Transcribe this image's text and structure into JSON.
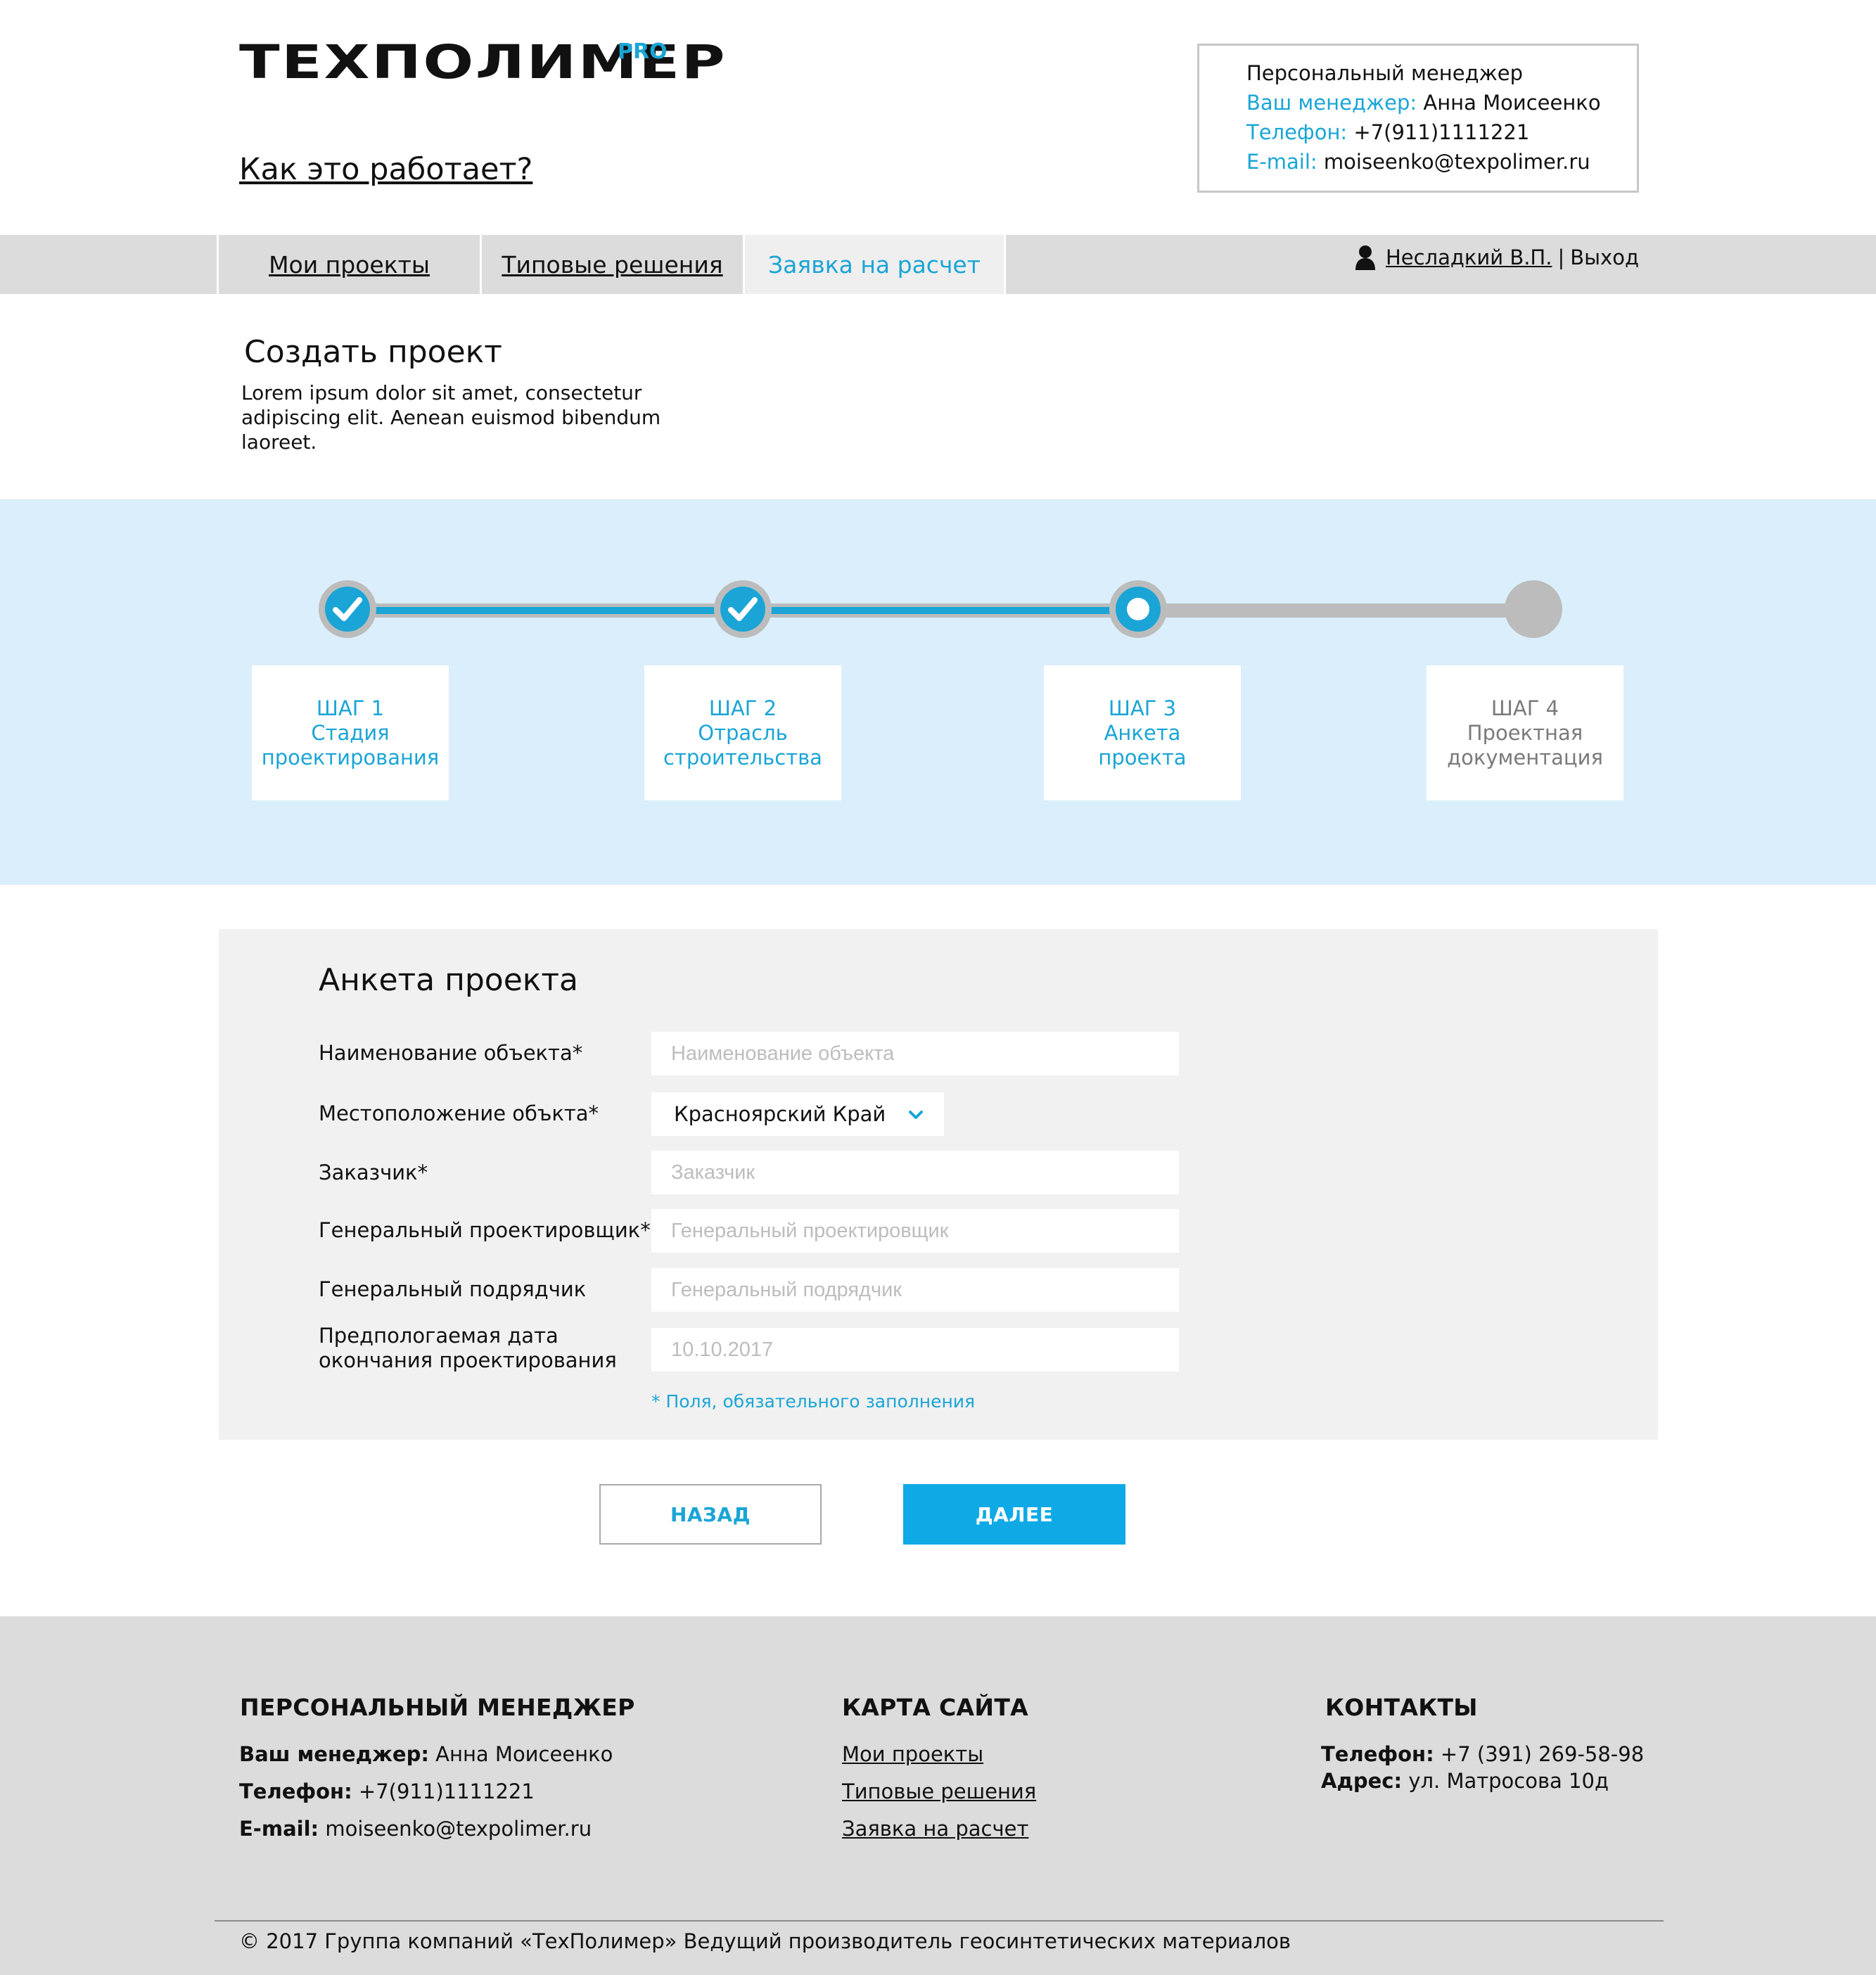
{
  "header": {
    "logo_text": "ТЕХПОЛИМЕР",
    "logo_suffix": "PRO",
    "how_it_works": "Как это работает?",
    "manager_box": {
      "title": "Персональный менеджер",
      "manager_label": "Ваш менеджер:",
      "manager_value": "Анна Моисеенко",
      "phone_label": "Телефон:",
      "phone_value": "+7(911)1111221",
      "email_label": "E-mail:",
      "email_value": "moiseenko@texpolimer.ru"
    }
  },
  "nav": {
    "tabs": [
      {
        "label": "Мои проекты",
        "active": false
      },
      {
        "label": "Типовые решения",
        "active": false
      },
      {
        "label": "Заявка на расчет",
        "active": true
      }
    ],
    "user_name": "Несладкий В.П.",
    "separator": "|",
    "logout": "Выход"
  },
  "intro": {
    "title": "Создать проект",
    "description": "Lorem ipsum dolor sit amet, consectetur adipiscing elit. Aenean euismod bibendum laoreet."
  },
  "stepper": {
    "steps": [
      {
        "number": "ШАГ 1",
        "name_line1": "Стадия",
        "name_line2": "проектирования",
        "state": "done"
      },
      {
        "number": "ШАГ 2",
        "name_line1": "Отрасль",
        "name_line2": "строительства",
        "state": "done"
      },
      {
        "number": "ШАГ 3",
        "name_line1": "Анкета",
        "name_line2": "проекта",
        "state": "current"
      },
      {
        "number": "ШАГ 4",
        "name_line1": "Проектная",
        "name_line2": "документация",
        "state": "todo"
      }
    ],
    "colors": {
      "active": "#1aa5d6",
      "inactive": "#bcbcbc",
      "band": "#dbeefb"
    }
  },
  "form": {
    "title": "Анкета проекта",
    "fields": {
      "object_name": {
        "label": "Наименование объекта*",
        "placeholder": "Наименование объекта"
      },
      "location": {
        "label": "Местоположение объкта*",
        "value": "Красноярский Край"
      },
      "customer": {
        "label": "Заказчик*",
        "placeholder": "Заказчик"
      },
      "general_designer": {
        "label": "Генеральный проектировщик*",
        "placeholder": "Генеральный проектировщик"
      },
      "general_contractor": {
        "label": "Генеральный подрядчик",
        "placeholder": "Генеральный подрядчик"
      },
      "end_date": {
        "label_line1": "Предпологаемая дата",
        "label_line2": "окончания проектирования",
        "placeholder": "10.10.2017"
      }
    },
    "required_note": "* Поля, обязательного заполнения"
  },
  "buttons": {
    "back": "НАЗАД",
    "next": "ДАЛЕЕ"
  },
  "footer": {
    "manager": {
      "heading": "ПЕРСОНАЛЬНЫЙ МЕНЕДЖЕР",
      "manager_label": "Ваш менеджер:",
      "manager_value": "Анна Моисеенко",
      "phone_label": "Телефон:",
      "phone_value": "+7(911)1111221",
      "email_label": "E-mail:",
      "email_value": "moiseenko@texpolimer.ru"
    },
    "sitemap": {
      "heading": "КАРТА САЙТА",
      "links": [
        "Мои проекты",
        "Типовые решения",
        "Заявка на расчет"
      ]
    },
    "contacts": {
      "heading": "КОНТАКТЫ",
      "phone_label": "Телефон:",
      "phone_value": "+7 (391) 269-58-98",
      "address_label": "Адрес:",
      "address_value": "ул. Матросова 10д"
    },
    "copyright": "© 2017 Группа компаний «ТехПолимер» Ведущий производитель геосинтетических материалов"
  },
  "icons": {
    "user": "user-icon",
    "dropdown": "chevron-down-icon",
    "step_done": "check-icon"
  }
}
